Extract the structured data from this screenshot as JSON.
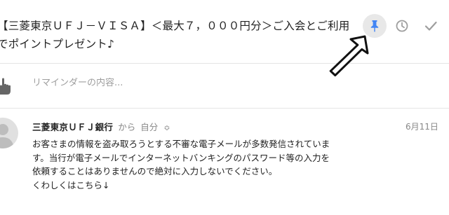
{
  "email": {
    "subject": "【三菱東京ＵＦＪ－ＶＩＳＡ】＜最大７，０００円分＞ご入会とご利用でポイントプレゼント♪",
    "reminder": {
      "placeholder": "リマインダーの内容..."
    },
    "message": {
      "sender": "三菱東京ＵＦＪ銀行",
      "from_label": "から",
      "to_label": "自分",
      "expand_symbol": "≎",
      "date": "6月11日",
      "body_lines": [
        "お客さまの情報を盗み取ろうとする不審な電子メールが多数発信されていま",
        "す。当行が電子メールでインターネットバンキングのパスワード等の入力を",
        "依頼することはありませんので絶対に入力しないでください。",
        "くわしくはこちら↓"
      ]
    }
  },
  "actions": {
    "pin_icon": "pin-icon",
    "snooze_icon": "clock-icon",
    "done_icon": "check-icon"
  },
  "colors": {
    "pin": "#4285f4",
    "pin_bg": "#e8e8e8",
    "muted": "#9e9e9e",
    "divider": "#e5e5e5"
  }
}
